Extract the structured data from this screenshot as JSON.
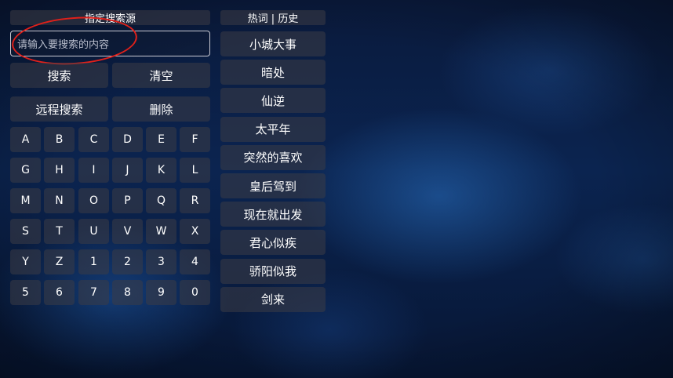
{
  "left_panel": {
    "header": "指定搜索源",
    "search": {
      "placeholder": "请输入要搜索的内容",
      "value": ""
    },
    "actions": {
      "search": "搜索",
      "clear": "清空",
      "remote_search": "远程搜索",
      "delete": "删除"
    },
    "keyboard_rows": [
      [
        "A",
        "B",
        "C",
        "D",
        "E",
        "F"
      ],
      [
        "G",
        "H",
        "I",
        "J",
        "K",
        "L"
      ],
      [
        "M",
        "N",
        "O",
        "P",
        "Q",
        "R"
      ],
      [
        "S",
        "T",
        "U",
        "V",
        "W",
        "X"
      ],
      [
        "Y",
        "Z",
        "1",
        "2",
        "3",
        "4"
      ],
      [
        "5",
        "6",
        "7",
        "8",
        "9",
        "0"
      ]
    ]
  },
  "right_panel": {
    "header": "热词 | 历史",
    "hot_words": [
      "小城大事",
      "暗处",
      "仙逆",
      "太平年",
      "突然的喜欢",
      "皇后驾到",
      "现在就出发",
      "君心似疾",
      "骄阳似我",
      "剑来"
    ]
  },
  "annotation": {
    "color": "#e0201a",
    "shape": "ellipse",
    "target": "search-input"
  },
  "colors": {
    "button_bg": "rgba(60,60,70,0.55)",
    "background": "#0b2450",
    "text": "#ffffff"
  }
}
